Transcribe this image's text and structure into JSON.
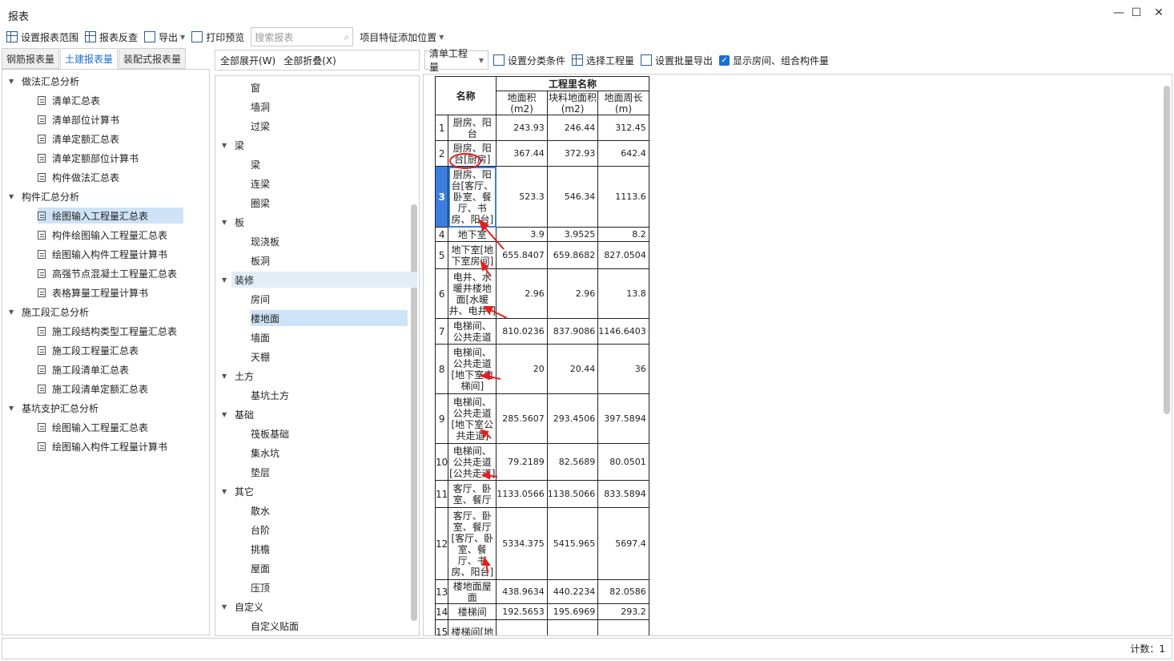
{
  "window": {
    "title": "报表",
    "minimize": "—",
    "maximize": "☐",
    "close": "✕"
  },
  "toolbar": {
    "set_range": "设置报表范围",
    "reverse_check": "报表反查",
    "export": "导出",
    "print_preview": "打印预览",
    "search_placeholder": "搜索报表",
    "feature_position": "项目特征添加位置"
  },
  "left_tabs": [
    "钢筋报表量",
    "土建报表量",
    "装配式报表量"
  ],
  "left_tree": [
    {
      "label": "做法汇总分析",
      "type": "group"
    },
    {
      "label": "清单汇总表",
      "type": "item"
    },
    {
      "label": "清单部位计算书",
      "type": "item"
    },
    {
      "label": "清单定额汇总表",
      "type": "item"
    },
    {
      "label": "清单定额部位计算书",
      "type": "item"
    },
    {
      "label": "构件做法汇总表",
      "type": "item"
    },
    {
      "label": "构件汇总分析",
      "type": "group"
    },
    {
      "label": "绘图输入工程量汇总表",
      "type": "item",
      "selected": true
    },
    {
      "label": "构件绘图输入工程量汇总表",
      "type": "item"
    },
    {
      "label": "绘图输入构件工程量计算书",
      "type": "item"
    },
    {
      "label": "高强节点混凝土工程量汇总表",
      "type": "item"
    },
    {
      "label": "表格算量工程量计算书",
      "type": "item"
    },
    {
      "label": "施工段汇总分析",
      "type": "group"
    },
    {
      "label": "施工段结构类型工程量汇总表",
      "type": "item"
    },
    {
      "label": "施工段工程量汇总表",
      "type": "item"
    },
    {
      "label": "施工段清单汇总表",
      "type": "item"
    },
    {
      "label": "施工段清单定额汇总表",
      "type": "item"
    },
    {
      "label": "基坑支护汇总分析",
      "type": "group"
    },
    {
      "label": "绘图输入工程量汇总表",
      "type": "item"
    },
    {
      "label": "绘图输入构件工程量计算书",
      "type": "item"
    }
  ],
  "middle": {
    "expand_all": "全部展开(W)",
    "collapse_all": "全部折叠(X)",
    "tree": [
      {
        "label": "窗",
        "type": "item"
      },
      {
        "label": "墙洞",
        "type": "item"
      },
      {
        "label": "过梁",
        "type": "item"
      },
      {
        "label": "梁",
        "type": "group"
      },
      {
        "label": "梁",
        "type": "item"
      },
      {
        "label": "连梁",
        "type": "item"
      },
      {
        "label": "圈梁",
        "type": "item"
      },
      {
        "label": "板",
        "type": "group"
      },
      {
        "label": "现浇板",
        "type": "item"
      },
      {
        "label": "板洞",
        "type": "item"
      },
      {
        "label": "装修",
        "type": "group",
        "highlight": true
      },
      {
        "label": "房间",
        "type": "item"
      },
      {
        "label": "楼地面",
        "type": "item",
        "selected": true
      },
      {
        "label": "墙面",
        "type": "item"
      },
      {
        "label": "天棚",
        "type": "item"
      },
      {
        "label": "土方",
        "type": "group"
      },
      {
        "label": "基坑土方",
        "type": "item"
      },
      {
        "label": "基础",
        "type": "group"
      },
      {
        "label": "筏板基础",
        "type": "item"
      },
      {
        "label": "集水坑",
        "type": "item"
      },
      {
        "label": "垫层",
        "type": "item"
      },
      {
        "label": "其它",
        "type": "group"
      },
      {
        "label": "散水",
        "type": "item"
      },
      {
        "label": "台阶",
        "type": "item"
      },
      {
        "label": "挑檐",
        "type": "item"
      },
      {
        "label": "屋面",
        "type": "item"
      },
      {
        "label": "压顶",
        "type": "item"
      },
      {
        "label": "自定义",
        "type": "group"
      },
      {
        "label": "自定义贴面",
        "type": "item"
      }
    ]
  },
  "right_toolbar": {
    "combo_value": "清单工程量",
    "classify": "设置分类条件",
    "select_project": "选择工程量",
    "batch_export": "设置批量导出",
    "show_rooms": "显示房间、组合构件量"
  },
  "table": {
    "header_name": "名称",
    "header_group": "工程里名称",
    "columns": [
      "地面积(m2)",
      "块料地面积(m2)",
      "地面周长(m)"
    ],
    "rows": [
      {
        "no": "1",
        "name": "厨房、阳台",
        "v": [
          "243.93",
          "246.44",
          "312.45"
        ]
      },
      {
        "no": "2",
        "name": "厨房、阳台[厨房]",
        "v": [
          "367.44",
          "372.93",
          "642.4"
        ]
      },
      {
        "no": "3",
        "name": "厨房、阳台[客厅、卧室、餐厅、书房、阳台]",
        "v": [
          "523.3",
          "546.34",
          "1113.6"
        ],
        "selected": true
      },
      {
        "no": "4",
        "name": "地下室",
        "v": [
          "3.9",
          "3.9525",
          "8.2"
        ]
      },
      {
        "no": "5",
        "name": "地下室[地下室房间]",
        "v": [
          "655.8407",
          "659.8682",
          "827.0504"
        ]
      },
      {
        "no": "6",
        "name": "电井、水暖井楼地面[水暖井、电井、]",
        "v": [
          "2.96",
          "2.96",
          "13.8"
        ]
      },
      {
        "no": "7",
        "name": "电梯间、公共走道",
        "v": [
          "810.0236",
          "837.9086",
          "1146.6403"
        ]
      },
      {
        "no": "8",
        "name": "电梯间、公共走道[地下室电梯间]",
        "v": [
          "20",
          "20.44",
          "36"
        ]
      },
      {
        "no": "9",
        "name": "电梯间、公共走道[地下室公共走道]",
        "v": [
          "285.5607",
          "293.4506",
          "397.5894"
        ]
      },
      {
        "no": "10",
        "name": "电梯间、公共走道[公共走道]",
        "v": [
          "79.2189",
          "82.5689",
          "80.0501"
        ]
      },
      {
        "no": "11",
        "name": "客厅、卧室、餐厅",
        "v": [
          "1133.0566",
          "1138.5066",
          "833.5894"
        ]
      },
      {
        "no": "12",
        "name": "客厅、卧室、餐厅[客厅、卧室、餐厅、书房、阳台]",
        "v": [
          "5334.375",
          "5415.965",
          "5697.4"
        ]
      },
      {
        "no": "13",
        "name": "楼地面屋面",
        "v": [
          "438.9634",
          "440.2234",
          "82.0586"
        ]
      },
      {
        "no": "14",
        "name": "楼梯间",
        "v": [
          "192.5653",
          "195.6969",
          "293.2"
        ]
      },
      {
        "no": "15",
        "name": "楼梯间[地",
        "v": [
          "",
          "",
          ""
        ]
      }
    ]
  },
  "status": {
    "count": "计数：1"
  }
}
